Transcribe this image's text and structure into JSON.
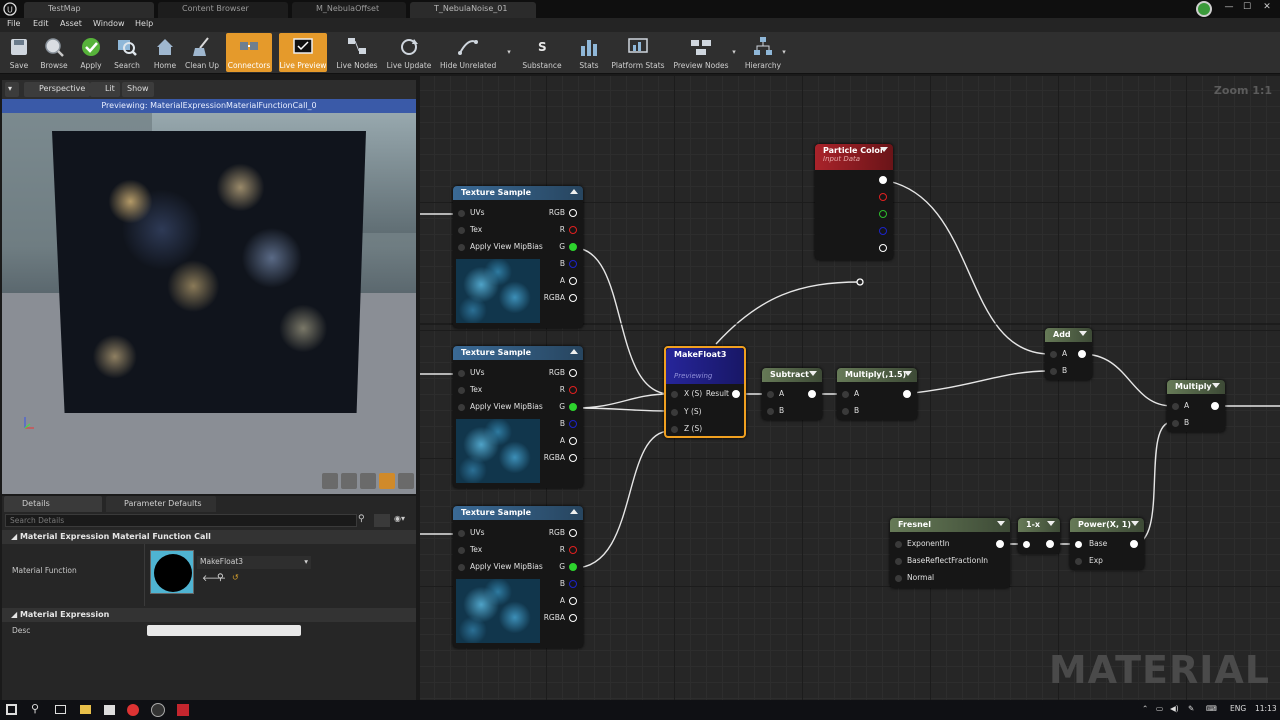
{
  "window": {
    "tabs": [
      {
        "label": "TestMap"
      },
      {
        "label": "Content Browser"
      },
      {
        "label": "M_NebulaOffset"
      },
      {
        "label": "T_NebulaNoise_01"
      }
    ]
  },
  "menu": [
    "File",
    "Edit",
    "Asset",
    "Window",
    "Help"
  ],
  "toolbar": [
    {
      "label": "Save",
      "icon": "save-icon"
    },
    {
      "label": "Browse",
      "icon": "browse-icon"
    },
    {
      "label": "Apply",
      "icon": "apply-icon"
    },
    {
      "label": "Search",
      "icon": "search-icon"
    },
    {
      "label": "Home",
      "icon": "home-icon"
    },
    {
      "label": "Clean Up",
      "icon": "clean-up-icon"
    },
    {
      "label": "Connectors",
      "icon": "connectors-icon",
      "active": true
    },
    {
      "label": "Live Preview",
      "icon": "live-preview-icon",
      "active": true
    },
    {
      "label": "Live Nodes",
      "icon": "live-nodes-icon"
    },
    {
      "label": "Live Update",
      "icon": "live-update-icon"
    },
    {
      "label": "Hide Unrelated",
      "icon": "hide-unrelated-icon"
    },
    {
      "label": "Substance",
      "icon": "substance-icon"
    },
    {
      "label": "Stats",
      "icon": "stats-icon"
    },
    {
      "label": "Platform Stats",
      "icon": "platform-stats-icon"
    },
    {
      "label": "Preview Nodes",
      "icon": "preview-nodes-icon"
    },
    {
      "label": "Hierarchy",
      "icon": "hierarchy-icon"
    }
  ],
  "viewport": {
    "perspective": "Perspective",
    "lit": "Lit",
    "show": "Show",
    "previewing": "Previewing: MaterialExpressionMaterialFunctionCall_0"
  },
  "details": {
    "tab_details": "Details",
    "tab_params": "Parameter Defaults",
    "search_placeholder": "Search Details",
    "section1": "Material Expression Material Function Call",
    "material_function_label": "Material Function",
    "material_function_value": "MakeFloat3",
    "section2": "Material Expression",
    "desc_label": "Desc"
  },
  "graph": {
    "zoom": "Zoom 1:1",
    "watermark": "MATERIAL",
    "texture_sample": {
      "title": "Texture Sample",
      "inputs": [
        "UVs",
        "Tex",
        "Apply View MipBias"
      ],
      "outputs": [
        "RGB",
        "R",
        "G",
        "B",
        "A",
        "RGBA"
      ]
    },
    "particle_color": {
      "title": "Particle Color",
      "subtitle": "Input Data"
    },
    "make_float3": {
      "title": "MakeFloat3",
      "subtitle": "Previewing",
      "inputs": [
        "X (S)",
        "Y (S)",
        "Z (S)"
      ],
      "output": "Result"
    },
    "subtract": {
      "title": "Subtract",
      "inputs": [
        "A",
        "B"
      ]
    },
    "multiply15": {
      "title": "Multiply(,1.5)",
      "inputs": [
        "A",
        "B"
      ]
    },
    "add": {
      "title": "Add",
      "inputs": [
        "A",
        "B"
      ]
    },
    "multiply": {
      "title": "Multiply",
      "inputs": [
        "A",
        "B"
      ]
    },
    "fresnel": {
      "title": "Fresnel",
      "inputs": [
        "ExponentIn",
        "BaseReflectFractionIn",
        "Normal"
      ]
    },
    "one_minus": {
      "title": "1-x"
    },
    "power": {
      "title": "Power(X, 1)",
      "inputs": [
        "Base",
        "Exp"
      ]
    }
  },
  "taskbar": {
    "lang": "ENG",
    "time": "11:13"
  }
}
